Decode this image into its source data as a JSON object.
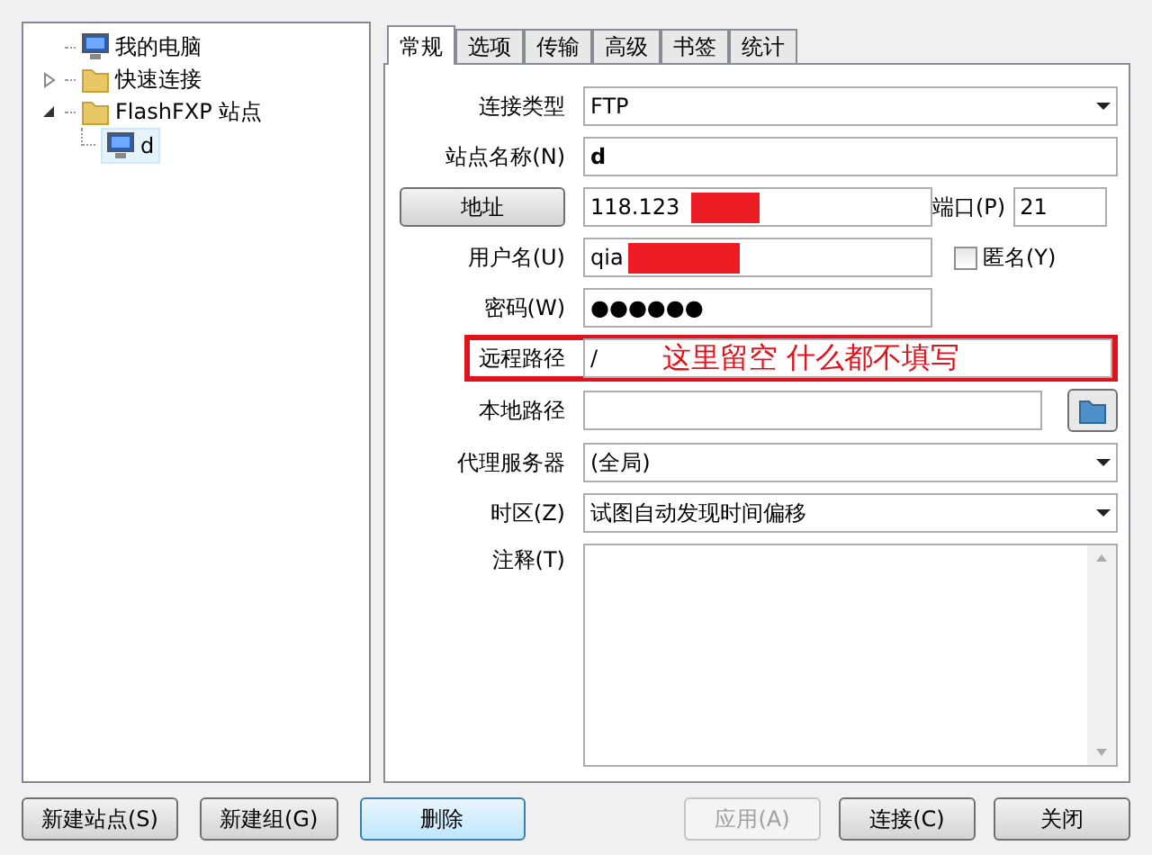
{
  "tree": [
    {
      "label": "我的电脑"
    },
    {
      "label": "快速连接",
      "expanded": false
    },
    {
      "label": "FlashFXP 站点",
      "expanded": true,
      "children": [
        {
          "label": "d",
          "selected": true
        }
      ]
    }
  ],
  "tabs": [
    {
      "label": "常规",
      "selected": true
    },
    {
      "label": "选项",
      "selected": false
    },
    {
      "label": "传输",
      "selected": false
    },
    {
      "label": "高级",
      "selected": false
    },
    {
      "label": "书签",
      "selected": false
    },
    {
      "label": "统计",
      "selected": false
    }
  ],
  "form": [
    {
      "kind": "select",
      "label": "连接类型",
      "value": "FTP"
    },
    {
      "kind": "name",
      "label": "站点名称(N)",
      "value": "d"
    },
    {
      "kind": "address",
      "button": "地址",
      "value": "118.123",
      "redacted": true,
      "port_label": "端口(P)",
      "port": "21"
    },
    {
      "kind": "user",
      "label": "用户名(U)",
      "value": "qia",
      "redacted": true,
      "checkbox": "匿名(Y)",
      "checked": false
    },
    {
      "kind": "password",
      "label": "密码(W)",
      "value": "●●●●●●"
    },
    {
      "kind": "annotated",
      "label": "远程路径",
      "value": "/",
      "note": "这里留空 什么都不填写"
    },
    {
      "kind": "browse",
      "label": "本地路径"
    },
    {
      "kind": "select",
      "label": "代理服务器",
      "value": "(全局)"
    },
    {
      "kind": "select",
      "label": "时区(Z)",
      "value": "试图自动发现时间偏移"
    },
    {
      "kind": "memo",
      "label": "注释(T)"
    }
  ],
  "buttons_left": [
    {
      "label": "新建站点(S)",
      "disabled": false,
      "focused": false
    },
    {
      "label": "新建组(G)",
      "disabled": false,
      "focused": false
    },
    {
      "label": "删除",
      "disabled": false,
      "focused": true
    }
  ],
  "buttons_right": [
    {
      "label": "应用(A)",
      "disabled": true,
      "focused": false
    },
    {
      "label": "连接(C)",
      "disabled": false,
      "focused": false
    },
    {
      "label": "关闭",
      "disabled": false,
      "focused": false
    }
  ]
}
